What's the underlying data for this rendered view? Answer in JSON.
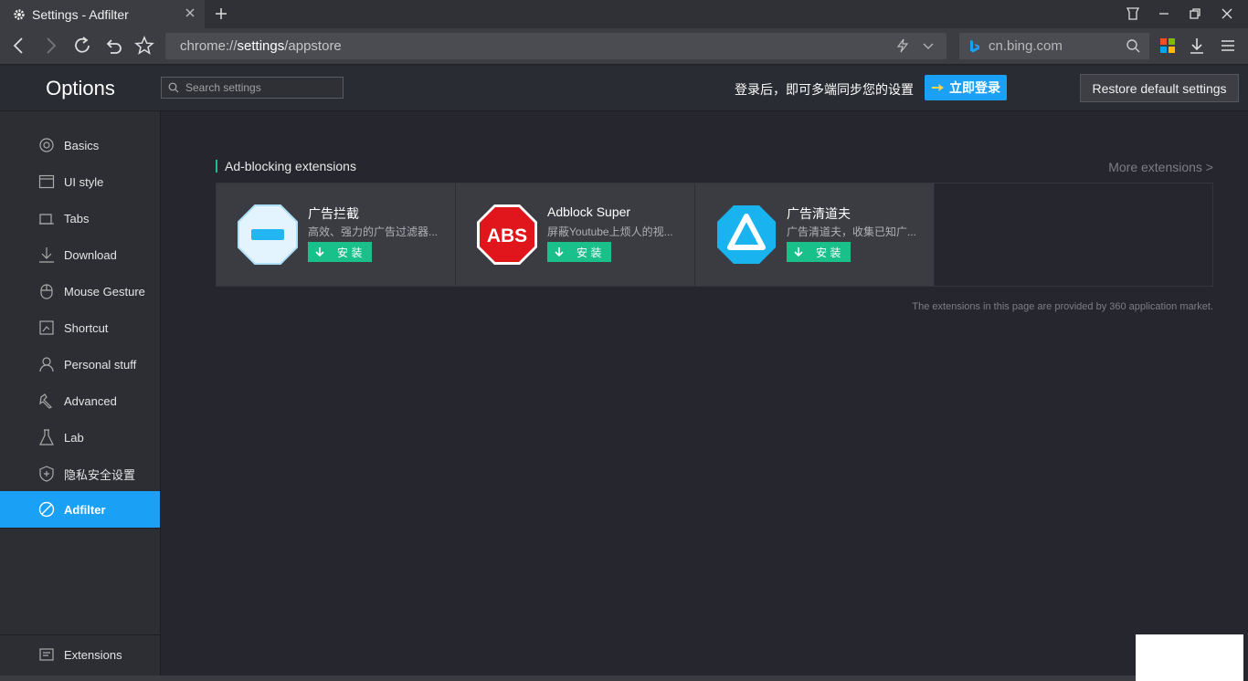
{
  "window": {
    "tab_title": "Settings - Adfilter"
  },
  "address": {
    "url_prefix": "chrome://",
    "url_bold": "settings",
    "url_suffix": "/appstore",
    "search_engine": "cn.bing.com"
  },
  "header": {
    "title": "Options",
    "search_placeholder": "Search settings",
    "sync_text": "登录后，即可多端同步您的设置",
    "login_label": "立即登录",
    "restore_label": "Restore default settings"
  },
  "sidebar": {
    "items": [
      {
        "label": "Basics",
        "icon": "target-icon"
      },
      {
        "label": "UI style",
        "icon": "window-icon"
      },
      {
        "label": "Tabs",
        "icon": "tab-icon"
      },
      {
        "label": "Download",
        "icon": "download-icon"
      },
      {
        "label": "Mouse Gesture",
        "icon": "mouse-icon"
      },
      {
        "label": "Shortcut",
        "icon": "shortcut-icon"
      },
      {
        "label": "Personal stuff",
        "icon": "person-icon"
      },
      {
        "label": "Advanced",
        "icon": "wrench-icon"
      },
      {
        "label": "Lab",
        "icon": "flask-icon"
      },
      {
        "label": "隐私安全设置",
        "icon": "shield-icon"
      },
      {
        "label": "Adfilter",
        "icon": "block-icon",
        "active": true
      }
    ],
    "extensions_label": "Extensions"
  },
  "main": {
    "section_title": "Ad-blocking extensions",
    "more_label": "More extensions >",
    "install_label": "安 装",
    "cards": [
      {
        "name": "广告拦截",
        "desc": "高效、强力的广告过滤器..."
      },
      {
        "name": "Adblock Super",
        "desc": "屏蔽Youtube上烦人的视..."
      },
      {
        "name": "广告清道夫",
        "desc": "广告清道夫，收集已知广..."
      }
    ],
    "footnote": "The extensions in this page are provided by 360 application market."
  },
  "icons": {
    "abs_text": "ABS"
  },
  "colors": {
    "accent": "#1aa0f5",
    "install_green": "#19c08a",
    "abs_red": "#e0161c"
  }
}
